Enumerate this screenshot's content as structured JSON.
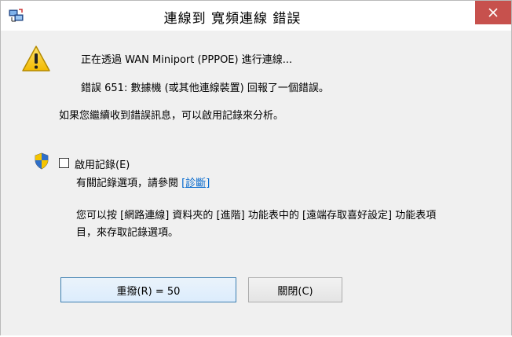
{
  "window": {
    "title": "連線到 寬頻連線 錯誤"
  },
  "message": {
    "line1": "正在透過 WAN Miniport (PPPOE) 進行連線...",
    "line2": "錯誤 651: 數據機 (或其他連線裝置) 回報了一個錯誤。",
    "line3": "如果您繼續收到錯誤訊息，可以啟用記錄來分析。"
  },
  "logging": {
    "checkbox_label": "啟用記錄(E)",
    "checked": false,
    "info_prefix": "有關記錄選項，請參閱 ",
    "link_label": "[診斷]",
    "hint_line1": "您可以按 [網路連線] 資料夾的 [進階] 功能表中的 [遠端存取喜好設定] 功能表項",
    "hint_line2": "目，來存取記錄選項。"
  },
  "buttons": {
    "redial": "重撥(R) = 50",
    "close": "關閉(C)"
  },
  "colors": {
    "close_button": "#c7514d",
    "link": "#0066cc",
    "window_bg": "#f0f0f0"
  },
  "icons": {
    "title": "network-connection-icon",
    "warning": "warning-icon",
    "uac": "uac-shield-icon",
    "close": "close-icon"
  }
}
